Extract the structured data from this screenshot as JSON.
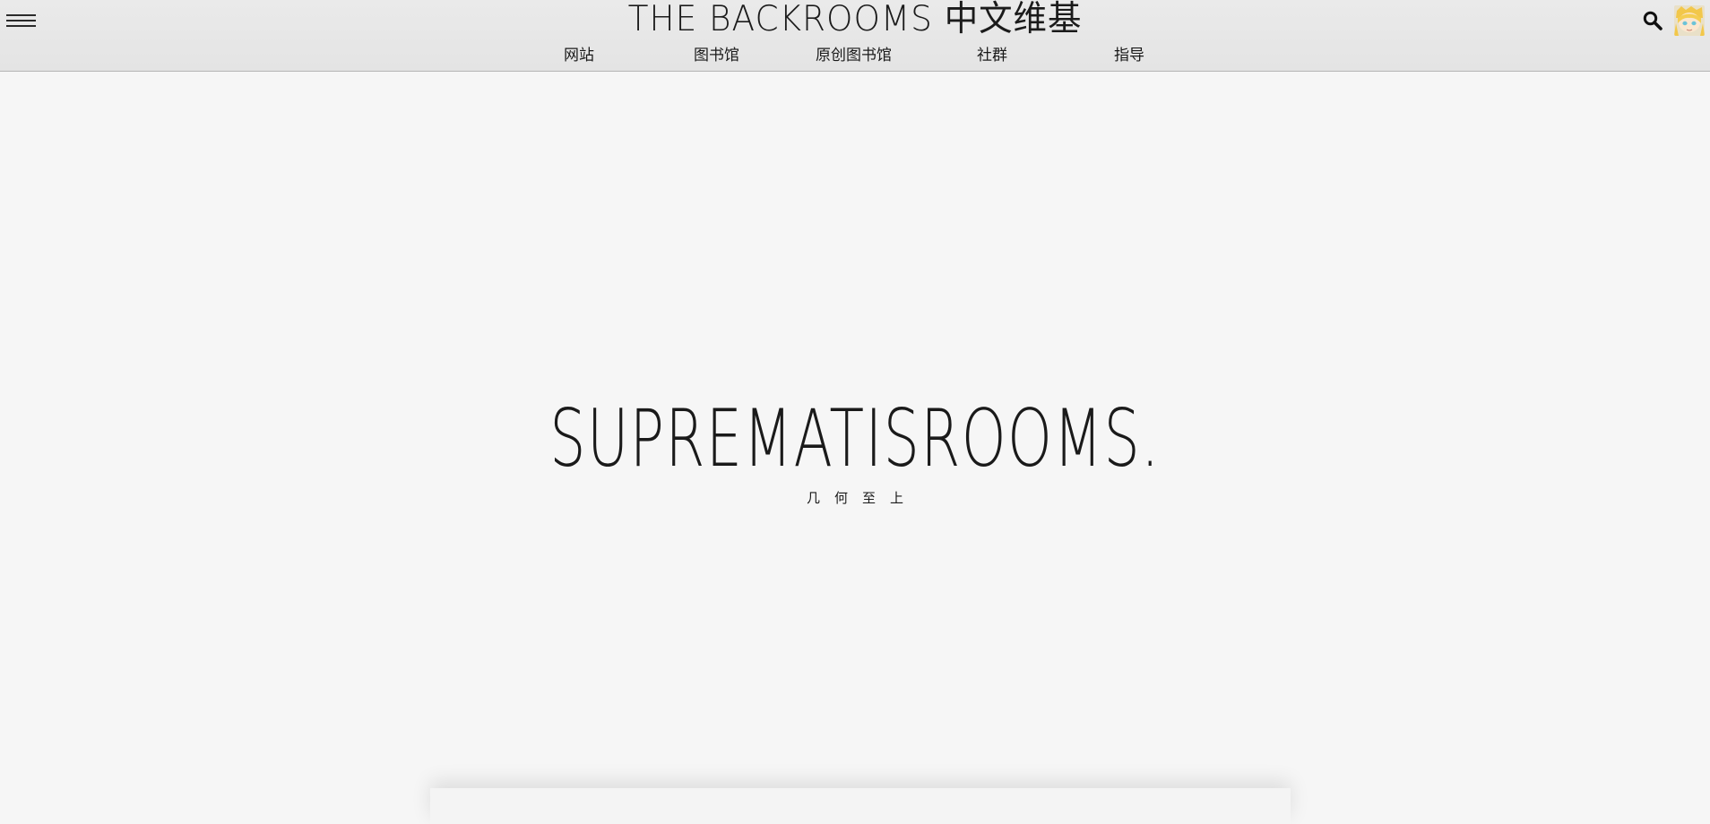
{
  "header": {
    "site_title": "THE BACKROOMS 中文维基",
    "menu_icon": "hamburger-menu-icon",
    "search_icon": "search-icon",
    "avatar_icon": "user-avatar-icon"
  },
  "nav": {
    "items": [
      {
        "label": "网站"
      },
      {
        "label": "图书馆"
      },
      {
        "label": "原创图书馆"
      },
      {
        "label": "社群"
      },
      {
        "label": "指导"
      }
    ]
  },
  "hero": {
    "title": "SUPREMATISROOMS.",
    "subtitle": "几何至上"
  },
  "colors": {
    "background": "#f6f6f6",
    "header_background": "#e8e8e8",
    "text": "#1a1a1a",
    "header_border": "#b5b5b5"
  }
}
